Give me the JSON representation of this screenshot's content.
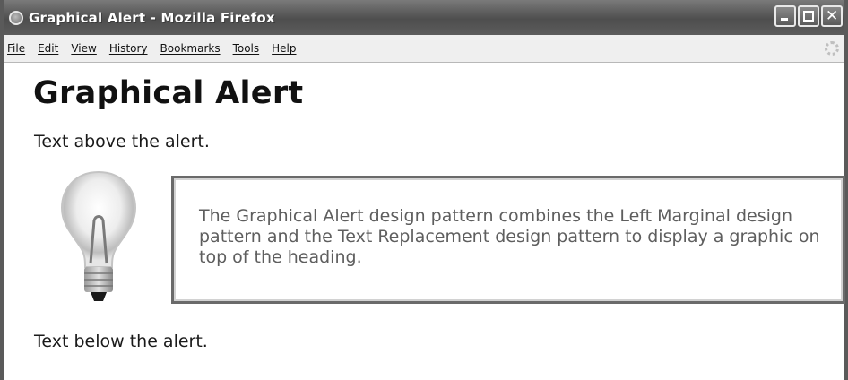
{
  "window": {
    "title": "Graphical Alert - Mozilla Firefox",
    "icon": "firefox-icon",
    "controls": [
      "minimize-icon",
      "maximize-icon",
      "close-icon"
    ]
  },
  "menubar": {
    "items": [
      "File",
      "Edit",
      "View",
      "History",
      "Bookmarks",
      "Tools",
      "Help"
    ],
    "status_icon": "throbber-icon"
  },
  "page": {
    "heading": "Graphical Alert",
    "text_above": "Text above the alert.",
    "alert": {
      "icon": "lightbulb-icon",
      "text": "The Graphical Alert design pattern combines the Left Marginal design pattern and the Text Replacement design pattern to display a graphic on top of the heading."
    },
    "text_below": "Text below the alert."
  }
}
